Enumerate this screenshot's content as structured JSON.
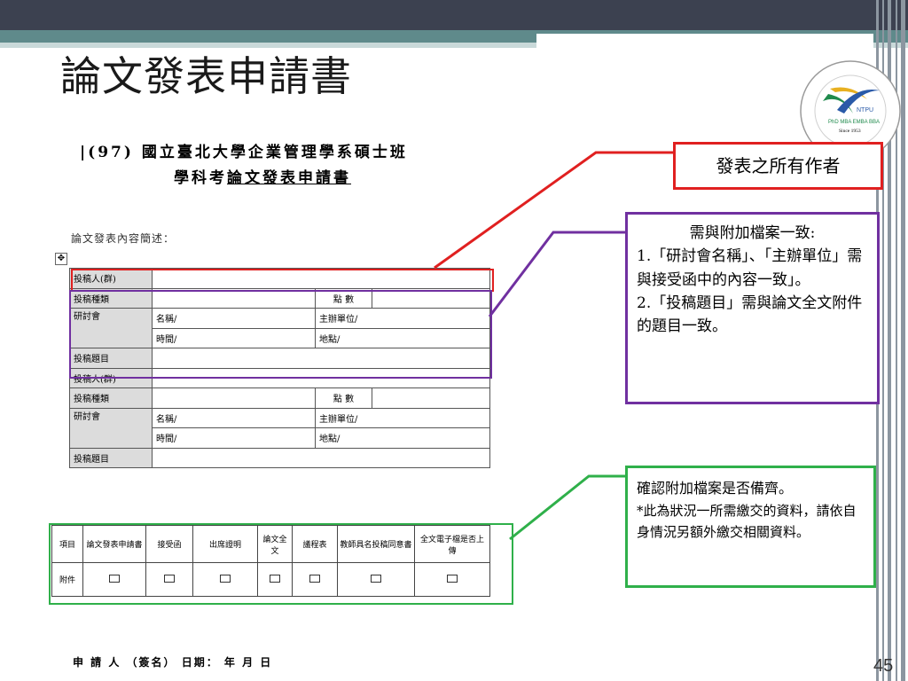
{
  "slide": {
    "title": "論文發表申請書",
    "page_number": "45"
  },
  "logo": {
    "name": "NTPU",
    "sub": "PhD MBA EMBA BBA",
    "since": "Since 1953"
  },
  "form": {
    "title_line1": "|(97) 國立臺北大學企業管理學系碩士班",
    "title_line2_a": "學科考",
    "title_line2_b": "論文發表申請書",
    "summary_label": "論文發表內容簡述：",
    "blocks": [
      {
        "author": "投稿人(群)",
        "type": "投稿種類",
        "points": "點 數",
        "conference": "研討會",
        "name": "名稱/",
        "organizer": "主辦單位/",
        "time": "時間/",
        "place": "地點/",
        "paper_title": "投稿題目"
      },
      {
        "author": "投稿人(群)",
        "type": "投稿種類",
        "points": "點 數",
        "conference": "研討會",
        "name": "名稱/",
        "organizer": "主辦單位/",
        "time": "時間/",
        "place": "地點/",
        "paper_title": "投稿題目"
      }
    ]
  },
  "attachments": {
    "headers": [
      "項目",
      "論文發表申請書",
      "接受函",
      "出席證明",
      "論文全文",
      "議程表",
      "教師具名投稿同意書",
      "全文電子檔是否上傳"
    ],
    "row_label": "附件"
  },
  "callouts": {
    "red": "發表之所有作者",
    "purple_heading": "需與附加檔案一致:",
    "purple_item1": "1.「研討會名稱」、「主辦單位」需與接受函中的內容一致」。",
    "purple_item2": "2.「投稿題目」需與論文全文附件的題目一致。",
    "green_heading": "確認附加檔案是否備齊。",
    "green_note": "*此為狀況一所需繳交的資料，請依自身情況另額外繳交相關資料。"
  },
  "signature": {
    "line": "申 請 人 （簽名） 日期： 年 月 日"
  },
  "colors": {
    "topbar": "#3c4150",
    "teal": "#5f8a8b",
    "red": "#e02020",
    "purple": "#7030a0",
    "green": "#2fb04a"
  }
}
